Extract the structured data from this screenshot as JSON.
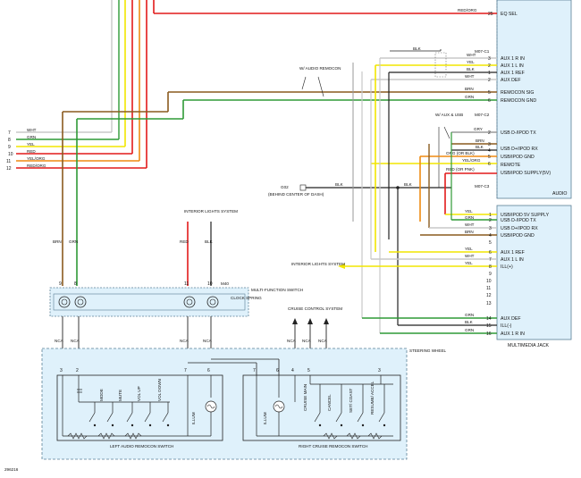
{
  "figure_id": "296216",
  "audio_unit": {
    "name": "AUDIO",
    "pins": [
      {
        "pin": "25",
        "label": "EQ SEL",
        "wire": "RED/ORG"
      },
      {
        "pin": "3",
        "label": "AUX 1 R IN",
        "wire": "WHT"
      },
      {
        "pin": "2",
        "label": "AUX 1 L IN",
        "wire": "YEL"
      },
      {
        "pin": "1",
        "label": "AUX 1 REF",
        "wire": "BLK"
      },
      {
        "pin": "2",
        "label": "AUX DEF",
        "wire": "WHT"
      },
      {
        "pin": "5",
        "label": "REMOCON SIG",
        "wire": "BRN"
      },
      {
        "pin": "6",
        "label": "REMOCON GND",
        "wire": "GRN"
      },
      {
        "pin": "2",
        "label": "USB D-/IPOD TX",
        "wire": "GRY"
      },
      {
        "pin": "3",
        "label": "USB D+/IPOD RX",
        "wire": "BRN"
      },
      {
        "pin": "4",
        "label": "USB/IPOD GND",
        "wire": "BLK"
      },
      {
        "pin": "5",
        "label": "REMOTE",
        "wire": "ORG (OR BLK)"
      },
      {
        "pin": "6",
        "label": "USB/IPOD SUPPLY(5V)",
        "wire": "YEL/ORG"
      }
    ],
    "connectors": [
      "M07-C1",
      "M07-C2",
      "M07-C3"
    ],
    "c3_wire": "RED (OR PNK)"
  },
  "multimedia_jack": {
    "name": "MULTIMEDIA JACK",
    "pins": [
      {
        "pin": "1",
        "label": "USB/IPOD 5V SUPPLY",
        "wire": "YEL"
      },
      {
        "pin": "2",
        "label": "USB D-/IPOD TX",
        "wire": "GRN"
      },
      {
        "pin": "3",
        "label": "USB D+/IPOD RX",
        "wire": "WHT"
      },
      {
        "pin": "4",
        "label": "USB/IPOD GND",
        "wire": "BRN"
      },
      {
        "pin": "5",
        "label": "",
        "wire": ""
      },
      {
        "pin": "6",
        "label": "AUX 1 REF",
        "wire": "YEL"
      },
      {
        "pin": "7",
        "label": "AUX 1 L IN",
        "wire": "WHT"
      },
      {
        "pin": "8",
        "label": "ILL(+)",
        "wire": "YEL"
      },
      {
        "pin": "9",
        "label": "",
        "wire": ""
      },
      {
        "pin": "10",
        "label": "",
        "wire": ""
      },
      {
        "pin": "11",
        "label": "",
        "wire": ""
      },
      {
        "pin": "12",
        "label": "",
        "wire": ""
      },
      {
        "pin": "13",
        "label": "",
        "wire": ""
      },
      {
        "pin": "14",
        "label": "AUX DEF",
        "wire": "GRN"
      },
      {
        "pin": "15",
        "label": "ILL(-)",
        "wire": "BLK"
      },
      {
        "pin": "16",
        "label": "AUX 1 R IN",
        "wire": "GRN"
      }
    ]
  },
  "left_wires": [
    {
      "num": "7",
      "label": "WHT"
    },
    {
      "num": "8",
      "label": "GRN"
    },
    {
      "num": "9",
      "label": "YEL"
    },
    {
      "num": "10",
      "label": "RED"
    },
    {
      "num": "11",
      "label": "YEL/ORG"
    },
    {
      "num": "12",
      "label": "RED/ORG"
    }
  ],
  "labels": {
    "audio_remocon": "W/ AUDIO REMOCON",
    "aux_usb": "W/ AUX & USB",
    "ground_id": "G02",
    "ground_desc": "(BEHIND CENTER OF DASH)",
    "interior_lights_1": "INTERIOR LIGHTS SYSTEM",
    "interior_lights_2": "INTERIOR LIGHTS SYSTEM",
    "mfs": "MULTI-FUNCTION SWITCH",
    "clock_spring": "CLOCK SPRING",
    "m40": "M40",
    "cruise_control": "CRUISE CONTROL SYSTEM",
    "steering_wheel": "STEERING WHEEL",
    "left_remocon": "LEFT AUDIO REMOCON SWITCH",
    "right_remocon": "RIGHT CRUISE REMOCON SWITCH",
    "nca": "NCA",
    "blk": "BLK",
    "brn": "BRN",
    "grn": "GRN",
    "red": "RED"
  },
  "left_switches": [
    "MODE",
    "MUTE",
    "VOL UP",
    "VOL DOWN",
    "ILLUM"
  ],
  "right_switches": [
    "ILLUM",
    "CRUISE MAIN",
    "CANCEL",
    "SET/ COAST",
    "RESUME/ ACCEL"
  ],
  "colors": {
    "red": "#e21a1a",
    "green": "#2e9a36",
    "yellow": "#f2e600",
    "white": "#c8c8c8",
    "brown": "#8a5a1e",
    "orange": "#ef8a12",
    "black": "#222222",
    "grey": "#9a9a9a",
    "box_fill": "#dff1fb",
    "box_stroke": "#5a7f96",
    "magenta": "#c23ab0"
  }
}
